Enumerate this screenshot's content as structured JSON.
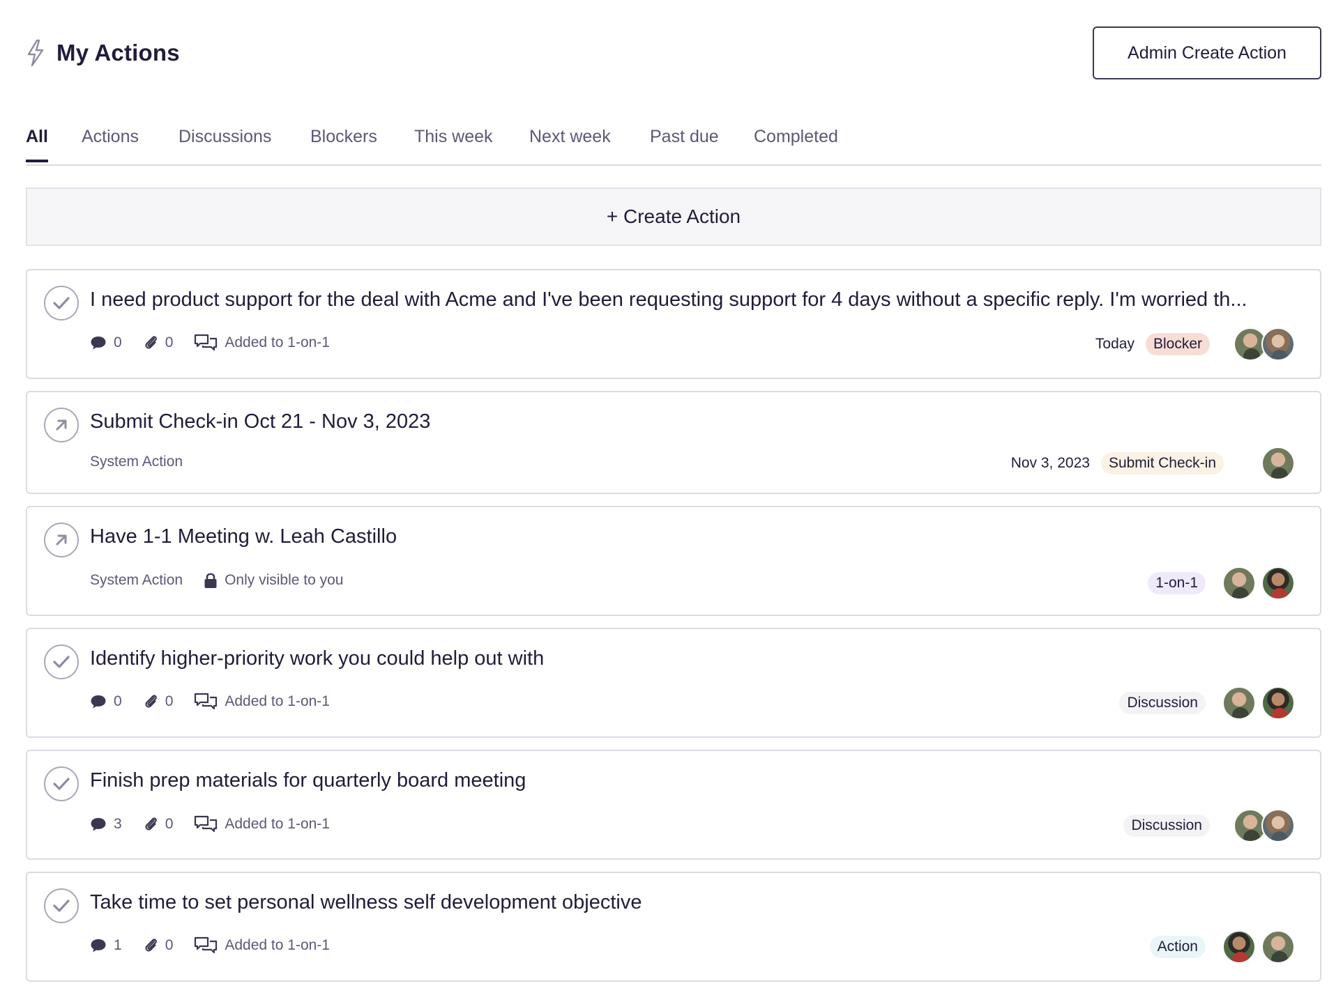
{
  "header": {
    "title": "My Actions",
    "title_icon": "bolt-icon",
    "admin_button": "Admin Create Action"
  },
  "tabs": [
    {
      "label": "All",
      "active": true
    },
    {
      "label": "Actions"
    },
    {
      "label": "Discussions"
    },
    {
      "label": "Blockers"
    },
    {
      "label": "This week"
    },
    {
      "label": "Next week"
    },
    {
      "label": "Past due"
    },
    {
      "label": "Completed"
    }
  ],
  "create_action": "+ Create Action",
  "colors": {
    "blocker_badge": "#f8ddd5",
    "checkin_badge": "#fbf1e4",
    "oneonone_badge": "#efe9fb",
    "discussion_badge": "#f3f3f6",
    "action_badge": "#e9f5f9"
  },
  "actions": [
    {
      "title": "I need product support for the deal with Acme and I've been requesting support for 4 days without a specific reply. I'm worried th...",
      "status_icon": "check-circle-icon",
      "comments": "0",
      "attachments": "0",
      "added_label": "Added to 1-on-1",
      "due": "Today",
      "badge": "Blocker"
    },
    {
      "title": "Submit Check-in Oct 21 - Nov 3, 2023",
      "status_icon": "arrow-up-right-circle-icon",
      "system_label": "System Action",
      "due": "Nov 3, 2023",
      "badge": "Submit Check-in"
    },
    {
      "title": "Have 1-1 Meeting w. Leah Castillo",
      "status_icon": "arrow-up-right-circle-icon",
      "system_label": "System Action",
      "visibility": "Only visible to you",
      "badge": "1-on-1"
    },
    {
      "title": "Identify higher-priority work you could help out with",
      "status_icon": "check-circle-icon",
      "comments": "0",
      "attachments": "0",
      "added_label": "Added to 1-on-1",
      "badge": "Discussion"
    },
    {
      "title": "Finish prep materials for quarterly board meeting",
      "status_icon": "check-circle-icon",
      "comments": "3",
      "attachments": "0",
      "added_label": "Added to 1-on-1",
      "badge": "Discussion"
    },
    {
      "title": "Take time to set personal wellness self development objective",
      "status_icon": "check-circle-icon",
      "comments": "1",
      "attachments": "0",
      "added_label": "Added to 1-on-1",
      "badge": "Action"
    }
  ]
}
